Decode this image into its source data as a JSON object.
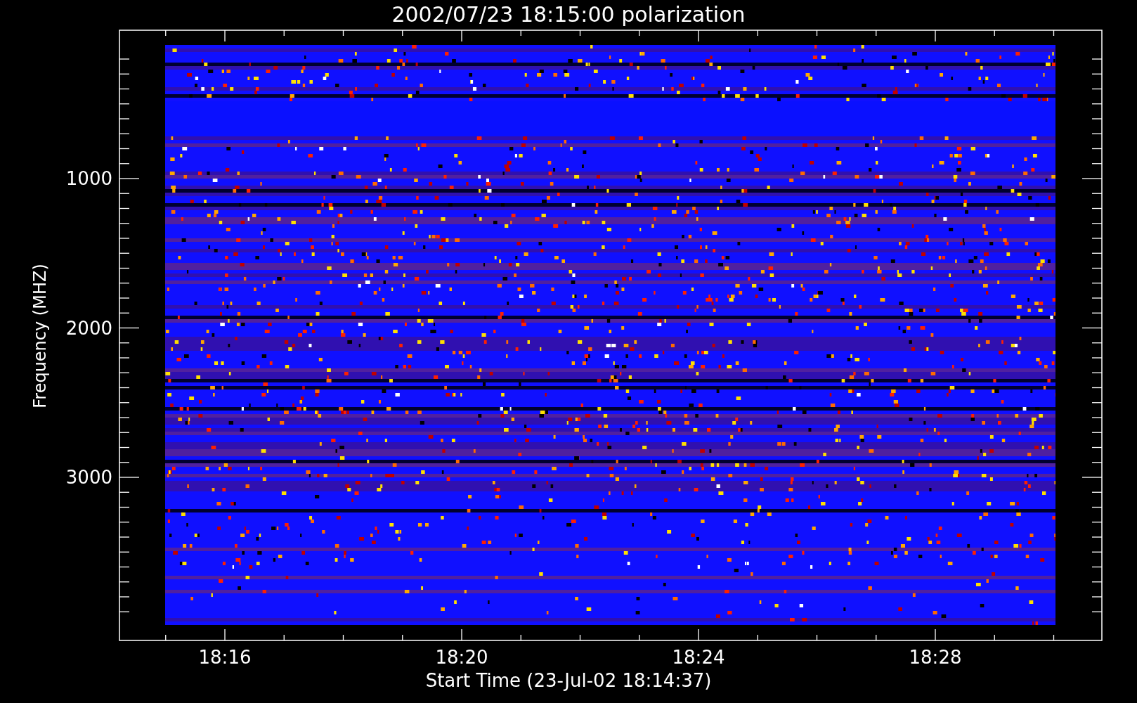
{
  "title": "2002/07/23 18:15:00 polarization",
  "y_axis": {
    "label": "Frequency (MHZ)",
    "ticks": [
      "1000",
      "2000",
      "3000"
    ]
  },
  "x_axis": {
    "label": "Start Time (23-Jul-02 18:14:37)",
    "ticks": [
      "18:16",
      "18:20",
      "18:24",
      "18:28"
    ]
  }
}
